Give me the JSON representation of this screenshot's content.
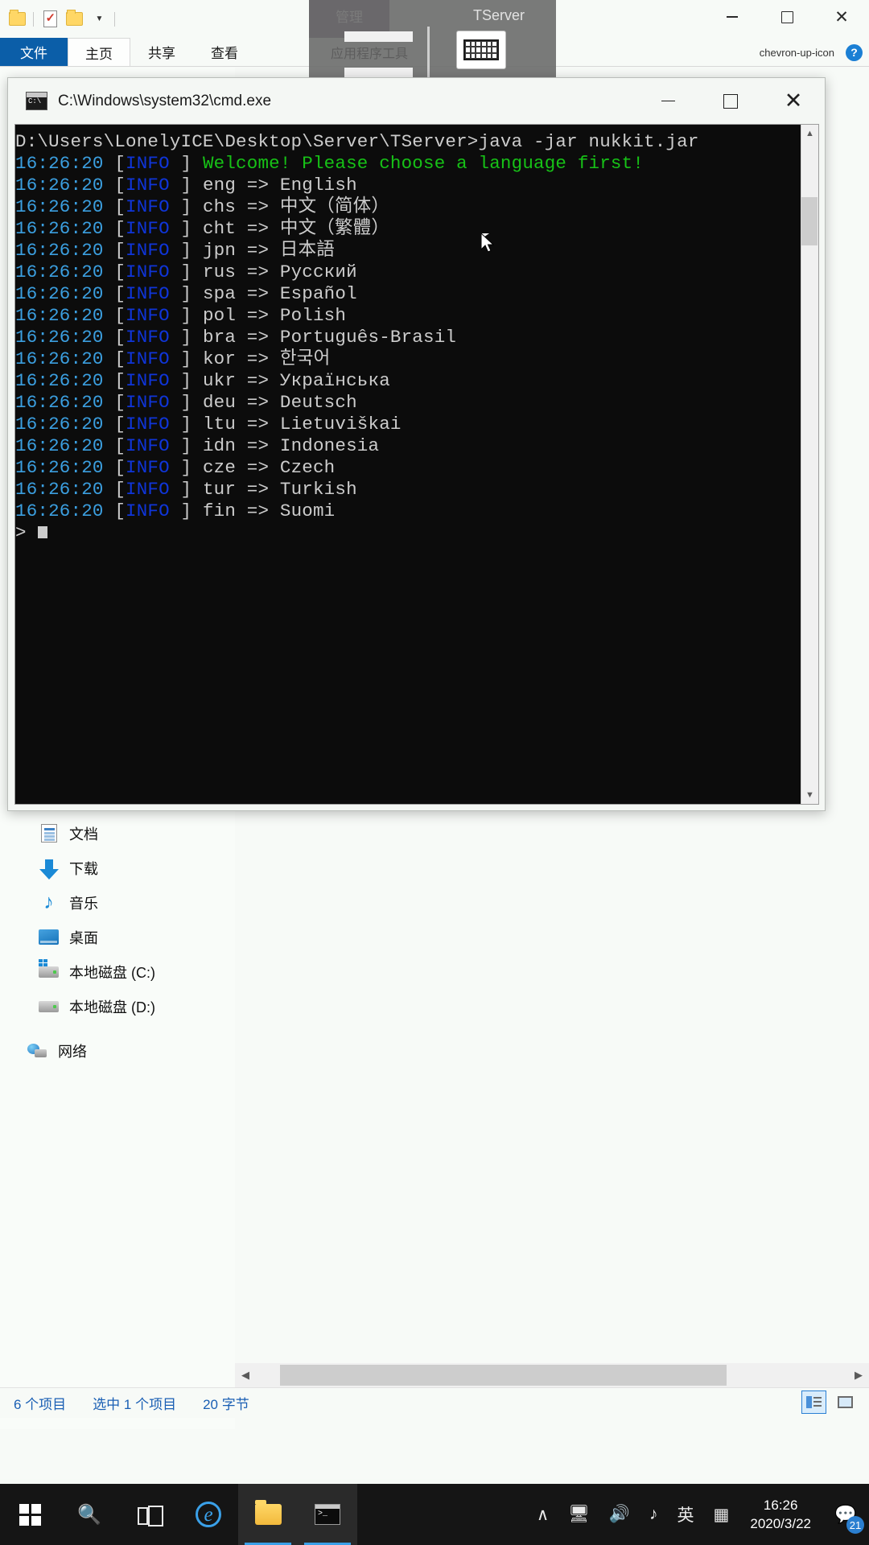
{
  "explorer": {
    "quick_access": {
      "folder_icon": "folder-icon",
      "checklist_icon": "properties-icon",
      "new_folder_icon": "new-folder-icon",
      "dropdown_icon": "chevron-down-icon"
    },
    "ribbon_tabs": [
      {
        "label": "文件",
        "active": false,
        "kind": "file"
      },
      {
        "label": "主页",
        "active": true,
        "kind": "normal"
      },
      {
        "label": "共享",
        "active": false,
        "kind": "normal"
      },
      {
        "label": "查看",
        "active": false,
        "kind": "normal"
      }
    ],
    "contextual_tab": {
      "label": "管理",
      "sub_label": "应用程序工具"
    },
    "help_icon": "help-icon",
    "collapse_ribbon_icon": "chevron-up-icon",
    "caption_buttons": {
      "minimize": "minimize-icon",
      "maximize": "maximize-icon",
      "close": "✕"
    },
    "nav_items": [
      {
        "label": "文档",
        "icon": "documents-icon"
      },
      {
        "label": "下载",
        "icon": "downloads-icon"
      },
      {
        "label": "音乐",
        "icon": "music-icon"
      },
      {
        "label": "桌面",
        "icon": "desktop-icon"
      },
      {
        "label": "本地磁盘 (C:)",
        "icon": "system-drive-icon"
      },
      {
        "label": "本地磁盘 (D:)",
        "icon": "drive-icon"
      },
      {
        "label": "网络",
        "icon": "network-icon"
      }
    ],
    "status": {
      "item_count": "6 个项目",
      "selection": "选中 1 个项目",
      "size": "20 字节",
      "details_view_icon": "details-view-icon",
      "large_icons_view_icon": "large-icons-view-icon"
    },
    "hscroll": {
      "left_arrow": "◀",
      "right_arrow": "▶"
    }
  },
  "ime_overlay": {
    "app_label": "TServer",
    "keyboard_icon": "keyboard-icon"
  },
  "console": {
    "title": "C:\\Windows\\system32\\cmd.exe",
    "icon": "cmd-icon",
    "caption_buttons": {
      "minimize": "minimize-icon",
      "maximize": "maximize-icon",
      "close": "✕"
    },
    "scroll": {
      "up_arrow": "▲",
      "down_arrow": "▼"
    },
    "prompt_line": "D:\\Users\\LonelyICE\\Desktop\\Server\\TServer>java -jar nukkit.jar",
    "timestamp": "16:26:20",
    "level": "INFO",
    "welcome": "Welcome! Please choose a language first!",
    "languages": [
      {
        "code": "eng",
        "name": "English"
      },
      {
        "code": "chs",
        "name": "中文（简体）"
      },
      {
        "code": "cht",
        "name": "中文（繁體）"
      },
      {
        "code": "jpn",
        "name": "日本語"
      },
      {
        "code": "rus",
        "name": "Русский"
      },
      {
        "code": "spa",
        "name": "Español"
      },
      {
        "code": "pol",
        "name": "Polish"
      },
      {
        "code": "bra",
        "name": "Português-Brasil"
      },
      {
        "code": "kor",
        "name": "한국어"
      },
      {
        "code": "ukr",
        "name": "Українська"
      },
      {
        "code": "deu",
        "name": "Deutsch"
      },
      {
        "code": "ltu",
        "name": "Lietuviškai"
      },
      {
        "code": "idn",
        "name": "Indonesia"
      },
      {
        "code": "cze",
        "name": "Czech"
      },
      {
        "code": "tur",
        "name": "Turkish"
      },
      {
        "code": "fin",
        "name": "Suomi"
      }
    ],
    "input_prompt": ">"
  },
  "taskbar": {
    "start_icon": "windows-start-icon",
    "search_icon": "search-icon",
    "taskview_icon": "task-view-icon",
    "apps": [
      {
        "name": "edge-icon",
        "active": false
      },
      {
        "name": "file-explorer-icon",
        "active": true
      },
      {
        "name": "command-prompt-icon",
        "active": true
      }
    ],
    "tray": {
      "show_hidden_icon": "∧",
      "network_icon": "network-tray-icon",
      "volume_icon": "volume-icon",
      "ime_tool_icon": "ime-tool-icon",
      "ime_mode": "英",
      "ime_keyboard_icon": "ime-keyboard-icon",
      "time": "16:26",
      "date": "2020/3/22",
      "action_center_icon": "action-center-icon",
      "notification_count": "21"
    }
  },
  "colors": {
    "accent": "#0b5ea8",
    "console_bg": "#0c0c0c",
    "console_info": "#0f35d9",
    "console_time": "#3b9fe0",
    "console_green": "#17c217",
    "taskbar": "#151515"
  }
}
